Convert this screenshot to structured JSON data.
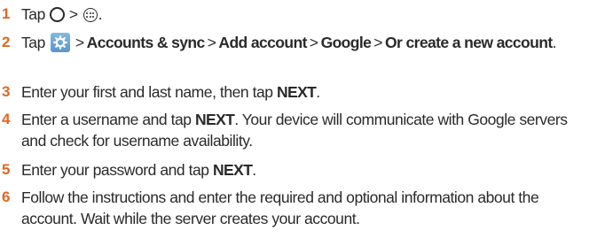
{
  "steps": [
    {
      "number": "1",
      "tap": "Tap",
      "gt": ">",
      "end": ".",
      "icons": [
        "home-circle-icon",
        "apps-icon"
      ]
    },
    {
      "number": "2",
      "tap": "Tap",
      "gt": ">",
      "path": [
        "Accounts & sync",
        "Add account",
        "Google",
        "Or create a new account"
      ],
      "end": ".",
      "icons": [
        "settings-icon"
      ]
    },
    {
      "number": "3",
      "text_before": "Enter your first and last name, then tap ",
      "bold": "NEXT",
      "text_after": "."
    },
    {
      "number": "4",
      "text_before": "Enter a username and tap ",
      "bold": "NEXT",
      "text_after_line1": ". Your device will communicate with Google servers",
      "text_line2": "and check for username availability."
    },
    {
      "number": "5",
      "text_before": "Enter your password and tap ",
      "bold": "NEXT",
      "text_after": "."
    },
    {
      "number": "6",
      "line1": "Follow the instructions and enter the required and optional information about the",
      "line2": "account. Wait while the server creates your account."
    }
  ],
  "colors": {
    "step_number": "#e3651d",
    "text": "#2a2a2a",
    "settings_icon_bg": "#6fa6d6"
  }
}
